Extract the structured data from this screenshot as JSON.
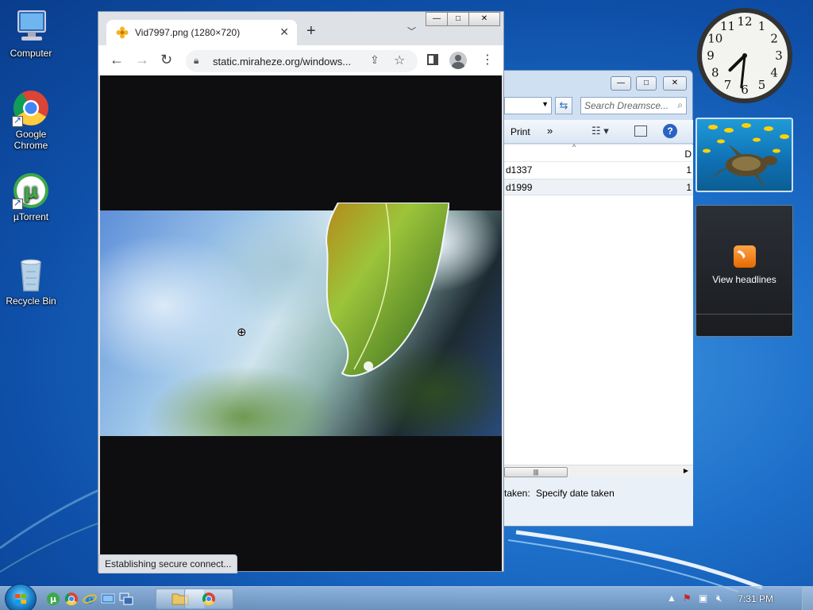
{
  "desktop": {
    "icons": [
      {
        "label": "Computer",
        "icon": "computer-icon"
      },
      {
        "label": "Google Chrome",
        "icon": "chrome-icon"
      },
      {
        "label": "µTorrent",
        "icon": "utorrent-icon"
      },
      {
        "label": "Recycle Bin",
        "icon": "recycle-bin-icon"
      }
    ]
  },
  "chrome": {
    "tab_title": "Vid7997.png (1280×720)",
    "url": "static.miraheze.org/windows...",
    "status": "Establishing secure connect...",
    "window_controls": {
      "minimize": "—",
      "maximize": "□",
      "close": "✕"
    }
  },
  "explorer": {
    "search_placeholder": "Search Dreamsce...",
    "toolbar": {
      "print": "Print",
      "more": "»"
    },
    "column_header": "D",
    "rows": [
      {
        "name": "d1337",
        "value": "1"
      },
      {
        "name": "d1999",
        "value": "1"
      }
    ],
    "details": {
      "label": "taken:",
      "value": "Specify date taken"
    }
  },
  "gadgets": {
    "clock": {
      "hour": 7,
      "minute": 31,
      "numerals": [
        "12",
        "1",
        "2",
        "3",
        "4",
        "5",
        "6",
        "7",
        "8",
        "9",
        "10",
        "11"
      ]
    },
    "feed_label": "View headlines"
  },
  "taskbar": {
    "time": "7:31 PM"
  },
  "colors": {
    "wallpaper": "#1d6fc9",
    "chrome_frame": "#dee1e6",
    "rss_orange": "#e66a00"
  }
}
